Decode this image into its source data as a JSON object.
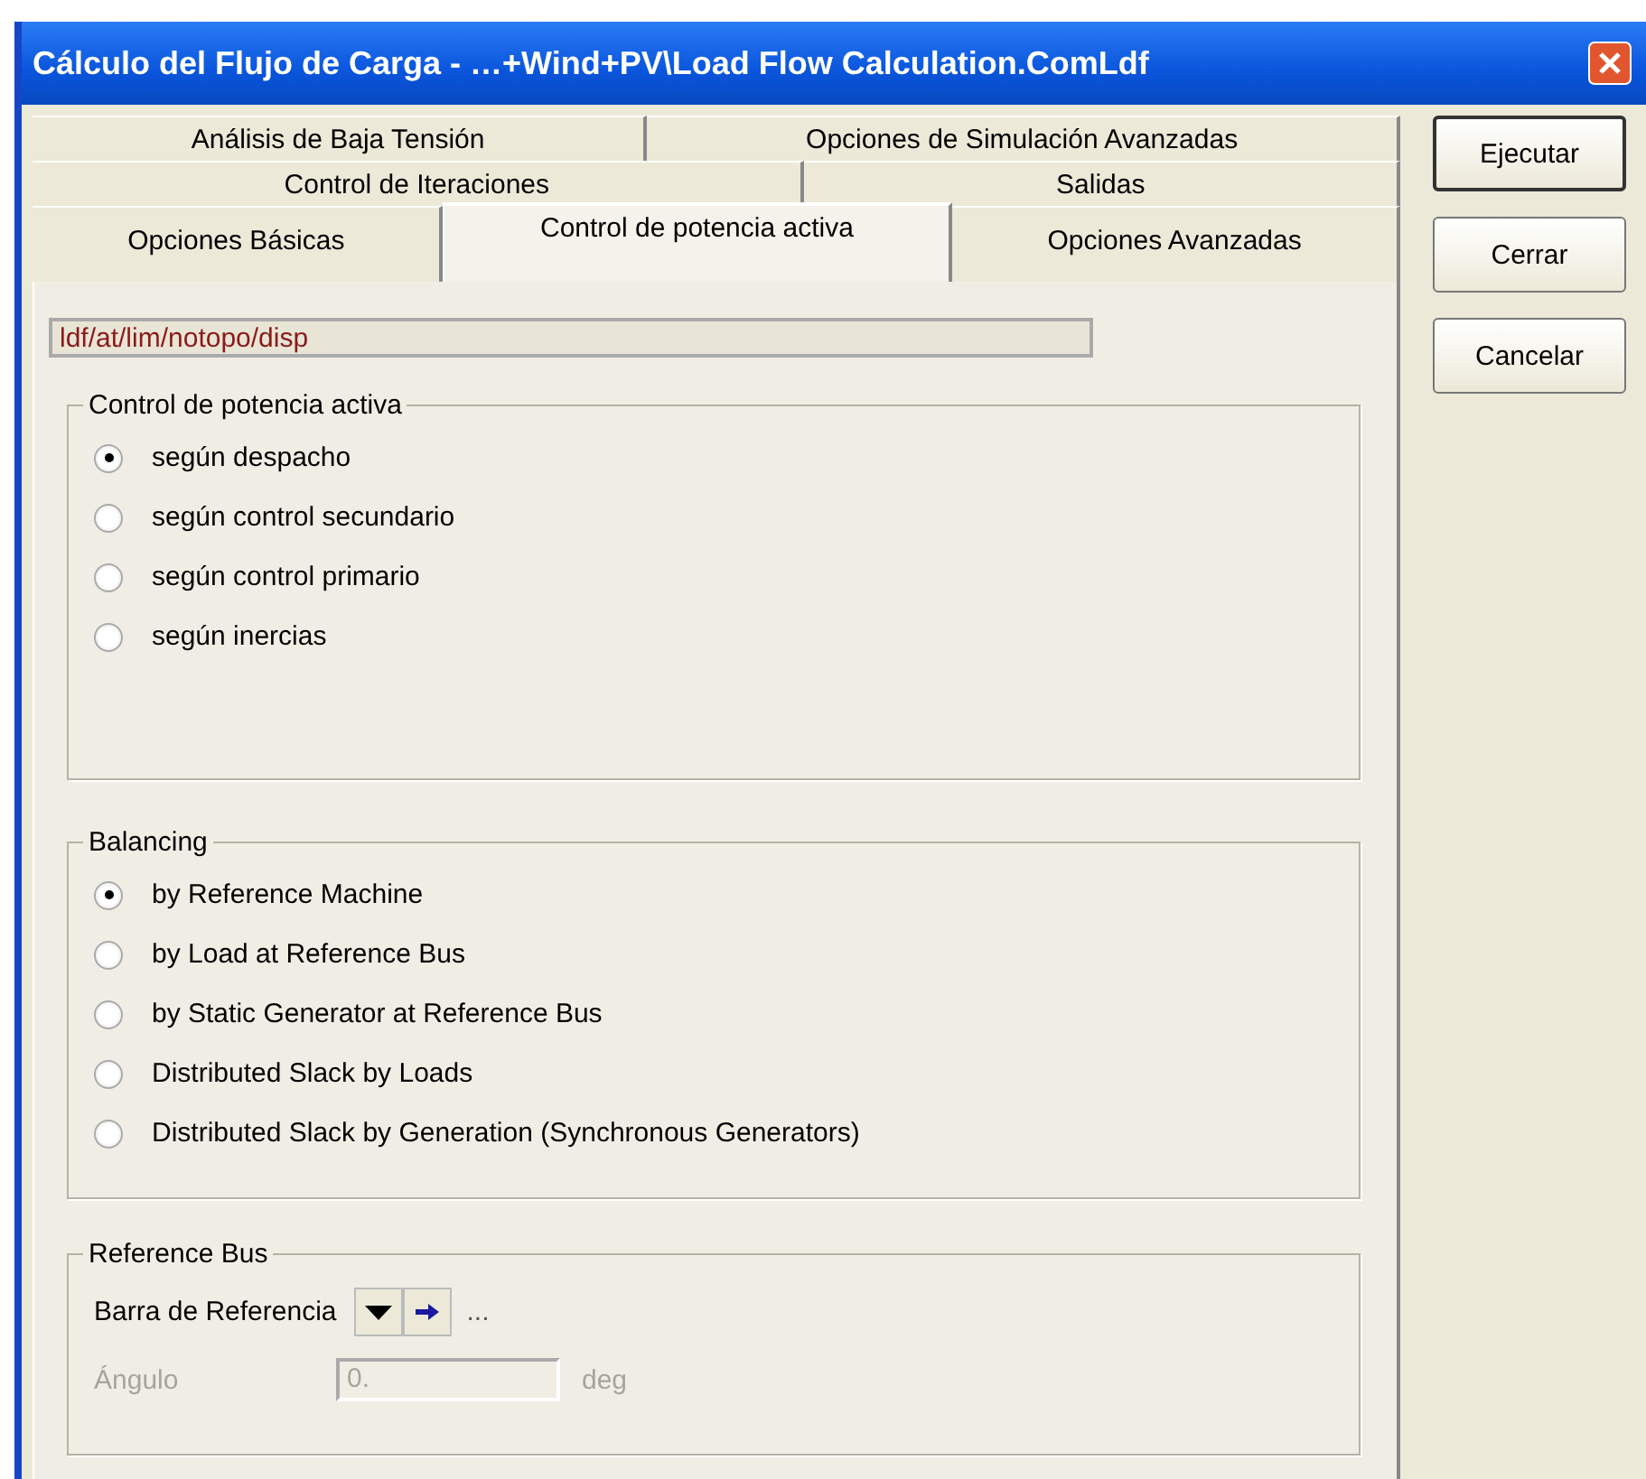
{
  "window": {
    "title": "Cálculo del Flujo de Carga - …+Wind+PV\\Load Flow Calculation.ComLdf"
  },
  "tab_rows": [
    [
      {
        "label": "Análisis de Baja Tensión",
        "selected": false
      },
      {
        "label": "Opciones de Simulación Avanzadas",
        "selected": false
      }
    ],
    [
      {
        "label": "Control de Iteraciones",
        "selected": false
      },
      {
        "label": "Salidas",
        "selected": false
      }
    ],
    [
      {
        "label": "Opciones Básicas",
        "selected": false
      },
      {
        "label": "Control de potencia activa",
        "selected": true
      },
      {
        "label": "Opciones Avanzadas",
        "selected": false
      }
    ]
  ],
  "buttons": [
    "Ejecutar",
    "Cerrar",
    "Cancelar"
  ],
  "path_field": {
    "value": "ldf/at/lim/notopo/disp"
  },
  "active_power_control": {
    "title": "Control de potencia activa",
    "options": [
      {
        "label": "según despacho",
        "selected": true
      },
      {
        "label": "según control secundario",
        "selected": false
      },
      {
        "label": "según control primario",
        "selected": false
      },
      {
        "label": "según inercias",
        "selected": false
      }
    ]
  },
  "balancing": {
    "title": "Balancing",
    "options": [
      {
        "label": "by Reference Machine",
        "selected": true
      },
      {
        "label": "by Load at Reference Bus",
        "selected": false
      },
      {
        "label": "by Static Generator at Reference Bus",
        "selected": false
      },
      {
        "label": "Distributed Slack by Loads",
        "selected": false
      },
      {
        "label": "Distributed Slack by Generation (Synchronous Generators)",
        "selected": false
      }
    ]
  },
  "reference_bus": {
    "title": "Reference Bus",
    "label": "Barra de Referencia",
    "value": "...",
    "angle": {
      "label": "Ángulo",
      "value": "0.",
      "unit": "deg",
      "disabled": true
    }
  }
}
